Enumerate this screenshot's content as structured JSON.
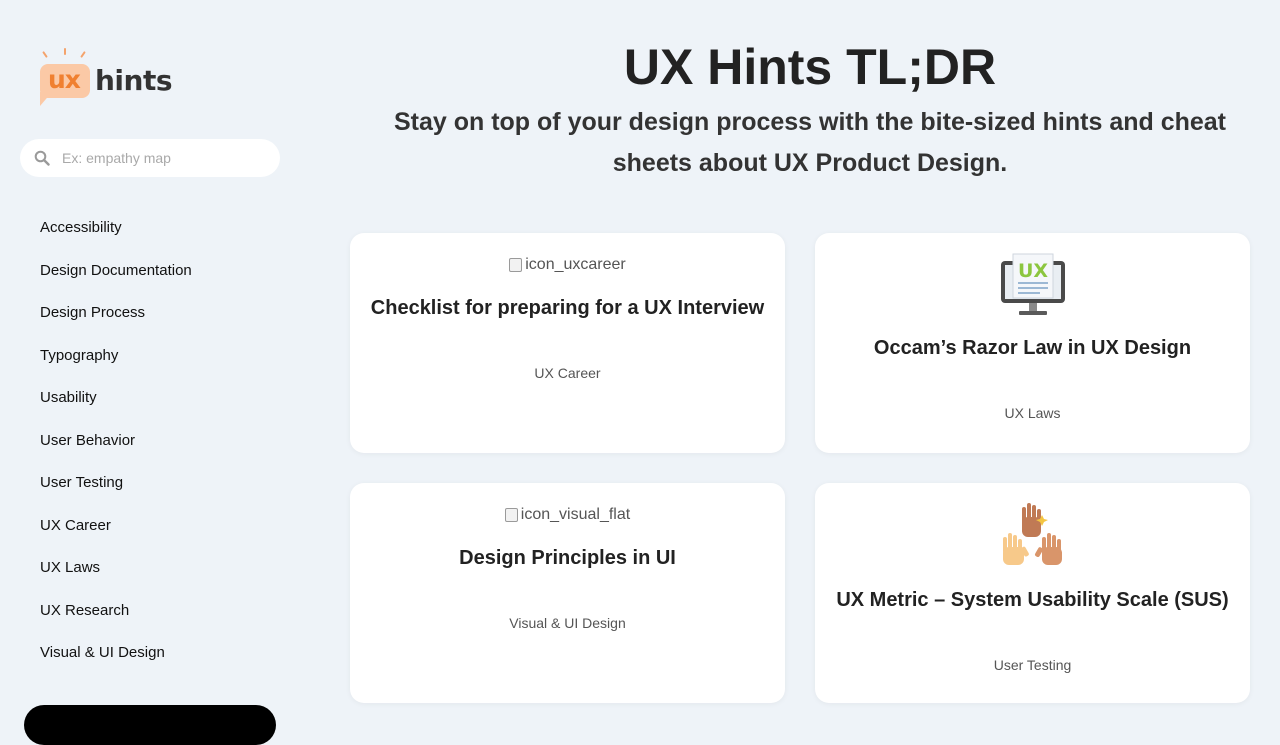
{
  "logo": {
    "badge_text": "ux",
    "text": "hints"
  },
  "search": {
    "placeholder": "Ex: empathy map",
    "value": ""
  },
  "nav": {
    "items": [
      "Accessibility",
      "Design Documentation",
      "Design Process",
      "Typography",
      "Usability",
      "User Behavior",
      "User Testing",
      "UX Career",
      "UX Laws",
      "UX Research",
      "Visual & UI Design"
    ]
  },
  "header": {
    "title": "UX Hints TL;DR",
    "subtitle": "Stay on top of your design process with the bite-sized hints and cheat sheets about UX Product Design."
  },
  "cards": [
    {
      "image_alt": "icon_uxcareer",
      "title": "Checklist for preparing for a UX Interview",
      "category": "UX Career"
    },
    {
      "image_icon": "ux-monitor-icon",
      "monitor_text": "UX",
      "title": "Occam’s Razor Law in UX Design",
      "category": "UX Laws"
    },
    {
      "image_alt": "icon_visual_flat",
      "title": "Design Principles in UI",
      "category": "Visual & UI Design"
    },
    {
      "image_icon": "raised-hands-icon",
      "title": "UX Metric – System Usability Scale (SUS)",
      "category": "User Testing"
    }
  ],
  "colors": {
    "background": "#eef3f8",
    "card": "#ffffff",
    "logo_accent": "#f08030",
    "logo_bubble": "#fbc9a6",
    "monitor_ux_green": "#8cc63f"
  }
}
